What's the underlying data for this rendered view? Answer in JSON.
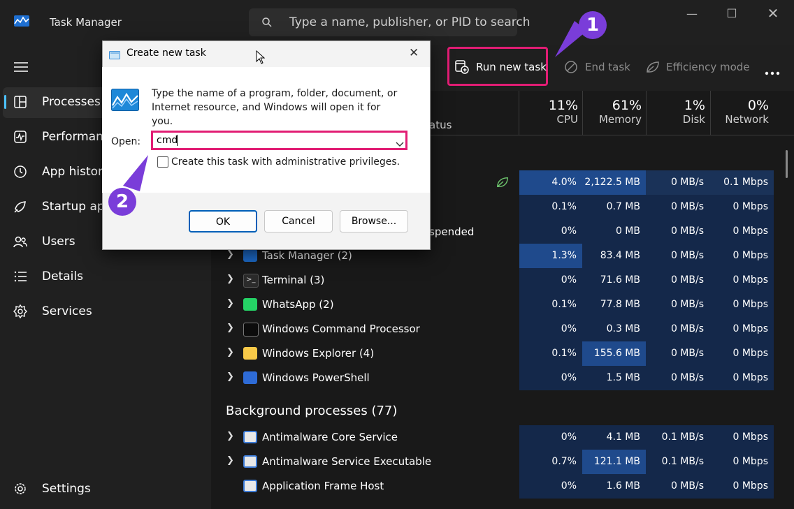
{
  "titlebar": {
    "app_title": "Task Manager",
    "search_placeholder": "Type a name, publisher, or PID to search"
  },
  "sidebar": {
    "items": [
      {
        "label": "Processes",
        "icon": "processes-icon"
      },
      {
        "label": "Performance",
        "icon": "performance-icon"
      },
      {
        "label": "App history",
        "icon": "app-history-icon"
      },
      {
        "label": "Startup apps",
        "icon": "startup-apps-icon"
      },
      {
        "label": "Users",
        "icon": "users-icon"
      },
      {
        "label": "Details",
        "icon": "details-icon"
      },
      {
        "label": "Services",
        "icon": "services-icon"
      }
    ],
    "settings_label": "Settings"
  },
  "toolbar": {
    "run_new_task": "Run new task",
    "end_task": "End task",
    "efficiency_mode": "Efficiency mode"
  },
  "columns": {
    "status": "atus",
    "cpu": {
      "pct": "11%",
      "label": "CPU"
    },
    "memory": {
      "pct": "61%",
      "label": "Memory"
    },
    "disk": {
      "pct": "1%",
      "label": "Disk"
    },
    "network": {
      "pct": "0%",
      "label": "Network"
    }
  },
  "apps_rows_partial": [
    {
      "status": "",
      "cpu": "4.0%",
      "mem": "2,122.5 MB",
      "disk": "0 MB/s",
      "net": "0.1 Mbps"
    },
    {
      "status": "",
      "cpu": "0.1%",
      "mem": "0.7 MB",
      "disk": "0 MB/s",
      "net": "0 Mbps"
    },
    {
      "status": "spended",
      "cpu": "0%",
      "mem": "0 MB",
      "disk": "0 MB/s",
      "net": "0 Mbps"
    }
  ],
  "apps_rows": [
    {
      "name": "Task Manager (2)",
      "cpu": "1.3%",
      "mem": "83.4 MB",
      "disk": "0 MB/s",
      "net": "0 Mbps"
    },
    {
      "name": "Terminal (3)",
      "cpu": "0%",
      "mem": "71.6 MB",
      "disk": "0 MB/s",
      "net": "0 Mbps"
    },
    {
      "name": "WhatsApp (2)",
      "cpu": "0.1%",
      "mem": "77.8 MB",
      "disk": "0 MB/s",
      "net": "0 Mbps"
    },
    {
      "name": "Windows Command Processor",
      "cpu": "0%",
      "mem": "0.3 MB",
      "disk": "0 MB/s",
      "net": "0 Mbps"
    },
    {
      "name": "Windows Explorer (4)",
      "cpu": "0.1%",
      "mem": "155.6 MB",
      "disk": "0 MB/s",
      "net": "0 Mbps"
    },
    {
      "name": "Windows PowerShell",
      "cpu": "0%",
      "mem": "1.5 MB",
      "disk": "0 MB/s",
      "net": "0 Mbps"
    }
  ],
  "background_section": "Background processes (77)",
  "background_rows": [
    {
      "name": "Antimalware Core Service",
      "cpu": "0%",
      "mem": "4.1 MB",
      "disk": "0.1 MB/s",
      "net": "0 Mbps"
    },
    {
      "name": "Antimalware Service Executable",
      "cpu": "0.7%",
      "mem": "121.1 MB",
      "disk": "0.1 MB/s",
      "net": "0 Mbps"
    },
    {
      "name": "Application Frame Host",
      "cpu": "0%",
      "mem": "1.6 MB",
      "disk": "0 MB/s",
      "net": "0 Mbps"
    }
  ],
  "dialog": {
    "title": "Create new task",
    "description": "Type the name of a program, folder, document, or Internet resource, and Windows will open it for you.",
    "open_label": "Open:",
    "open_value": "cmd",
    "admin_label": "Create this task with administrative privileges.",
    "ok": "OK",
    "cancel": "Cancel",
    "browse": "Browse..."
  },
  "callouts": {
    "one": "1",
    "two": "2"
  },
  "colors": {
    "highlight": "#e11d74",
    "callout": "#7a3dd9",
    "accent": "#4cc2ff"
  }
}
